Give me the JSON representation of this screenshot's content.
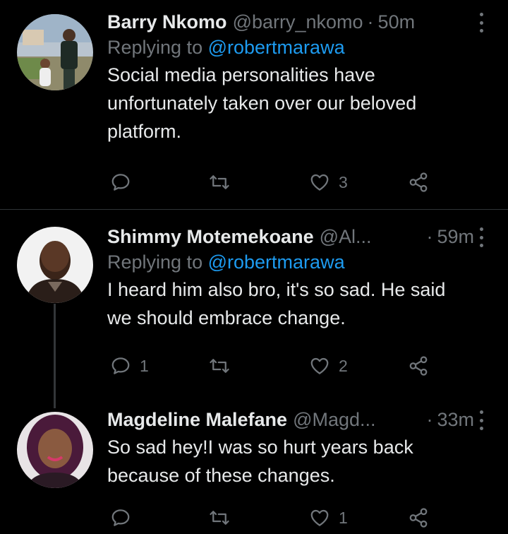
{
  "tweets": [
    {
      "name": "Barry Nkomo",
      "handle": "@barry_nkomo",
      "separator": "·",
      "time": "50m",
      "replying_prefix": "Replying to",
      "replying_to": "@robertmarawa",
      "text_lines": [
        "Social media personalities have",
        "unfortunately taken over our beloved",
        "platform."
      ],
      "replies": "",
      "retweets": "",
      "likes": "3"
    },
    {
      "name": "Shimmy Motemekoane",
      "handle": "@Al...",
      "separator": "·",
      "time": "59m",
      "replying_prefix": "Replying to",
      "replying_to": "@robertmarawa",
      "text_lines": [
        "I heard him also bro, it's so sad. He said",
        "we should embrace change."
      ],
      "replies": "1",
      "retweets": "",
      "likes": "2"
    },
    {
      "name": "Magdeline Malefane",
      "handle": "@Magd...",
      "separator": "·",
      "time": "33m",
      "text_lines": [
        "So sad hey!I was so hurt years back",
        "because of these changes."
      ],
      "replies": "",
      "retweets": "",
      "likes": "1"
    }
  ],
  "icons": {
    "reply": "reply-icon",
    "retweet": "retweet-icon",
    "like": "heart-icon",
    "share": "share-icon",
    "more": "more-options-icon"
  },
  "colors": {
    "background": "#000000",
    "primary_text": "#e7e9ea",
    "secondary_text": "#71767b",
    "link": "#1d9bf0",
    "divider": "#2f3336"
  }
}
